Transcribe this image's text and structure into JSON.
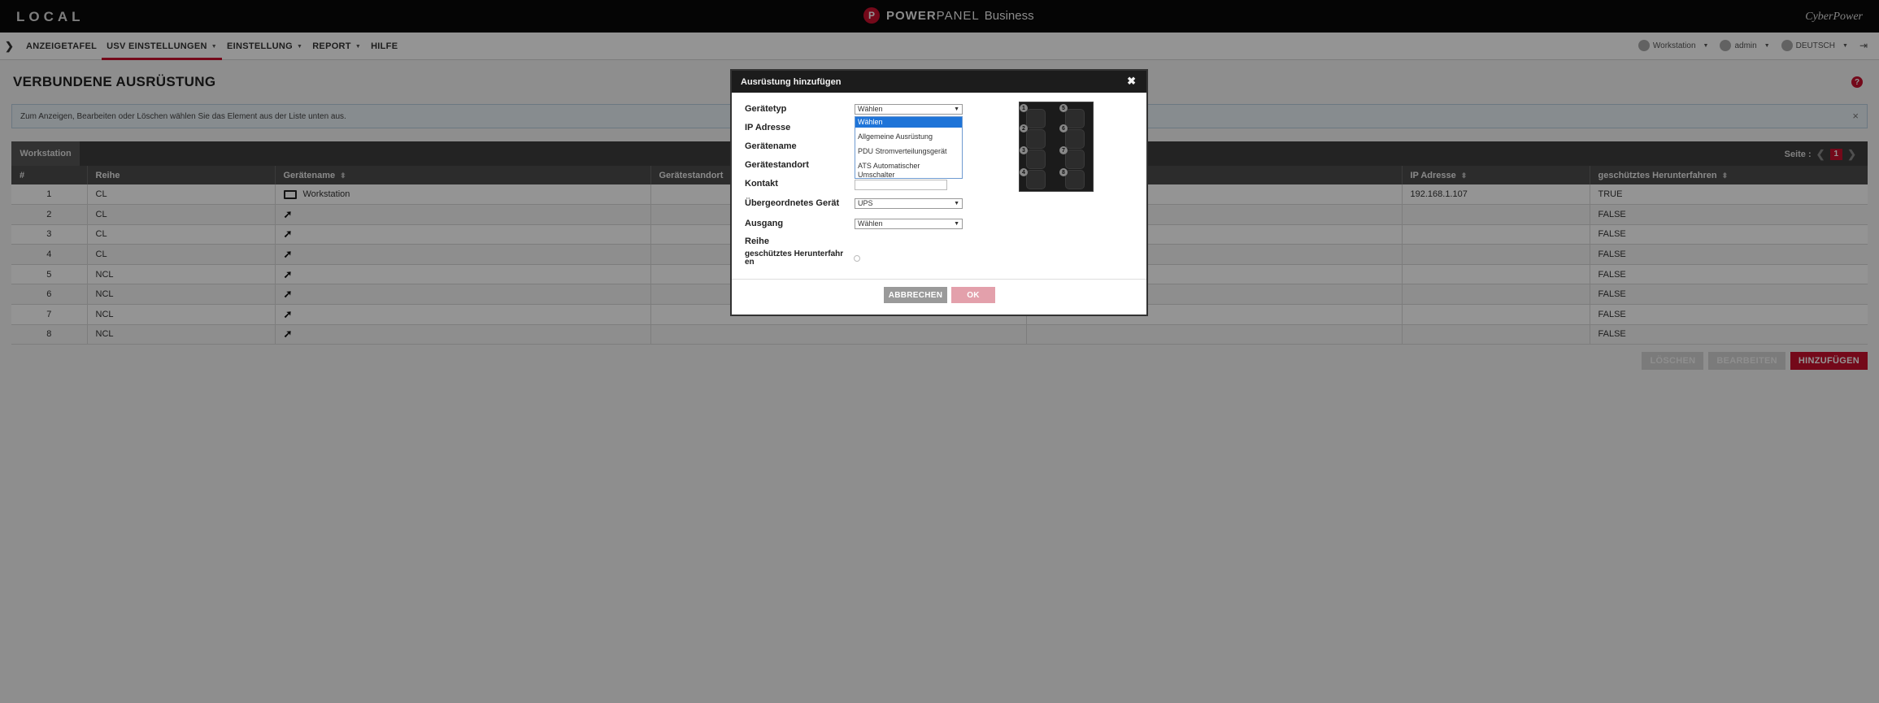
{
  "topbar": {
    "local_logo": "LOCAL",
    "product_brand_a": "POWER",
    "product_brand_b": "PANEL",
    "product_suffix": "Business",
    "vendor_logo": "CyberPower"
  },
  "nav": {
    "items": [
      {
        "label": "ANZEIGETAFEL",
        "active": false,
        "has_menu": false
      },
      {
        "label": "USV EINSTELLUNGEN",
        "active": true,
        "has_menu": true
      },
      {
        "label": "EINSTELLUNG",
        "active": false,
        "has_menu": true
      },
      {
        "label": "REPORT",
        "active": false,
        "has_menu": true
      },
      {
        "label": "HILFE",
        "active": false,
        "has_menu": false
      }
    ],
    "right": {
      "workstation": "Workstation",
      "user": "admin",
      "language": "DEUTSCH"
    }
  },
  "page": {
    "title": "VERBUNDENE AUSRÜSTUNG",
    "info_text": "Zum Anzeigen, Bearbeiten oder Löschen wählen Sie das Element aus der Liste unten aus.",
    "tab_label": "Workstation",
    "pager_label": "Seite :",
    "current_page": "1"
  },
  "table": {
    "columns": [
      "#",
      "Reihe",
      "Gerätename",
      "Gerätestandort",
      "",
      "IP Adresse",
      "geschütztes Herunterfahren"
    ],
    "rows": [
      {
        "num": "1",
        "reihe": "CL",
        "name": "Workstation",
        "icon": "workstation-icon",
        "ip": "192.168.1.107",
        "shutdown": "TRUE"
      },
      {
        "num": "2",
        "reihe": "CL",
        "name": "",
        "icon": "plug-icon",
        "ip": "",
        "shutdown": "FALSE"
      },
      {
        "num": "3",
        "reihe": "CL",
        "name": "",
        "icon": "plug-icon",
        "ip": "",
        "shutdown": "FALSE"
      },
      {
        "num": "4",
        "reihe": "CL",
        "name": "",
        "icon": "plug-icon",
        "ip": "",
        "shutdown": "FALSE"
      },
      {
        "num": "5",
        "reihe": "NCL",
        "name": "",
        "icon": "plug-icon",
        "ip": "",
        "shutdown": "FALSE"
      },
      {
        "num": "6",
        "reihe": "NCL",
        "name": "",
        "icon": "plug-icon",
        "ip": "",
        "shutdown": "FALSE"
      },
      {
        "num": "7",
        "reihe": "NCL",
        "name": "",
        "icon": "plug-icon",
        "ip": "",
        "shutdown": "FALSE"
      },
      {
        "num": "8",
        "reihe": "NCL",
        "name": "",
        "icon": "plug-icon",
        "ip": "",
        "shutdown": "FALSE"
      }
    ]
  },
  "actions": {
    "delete": "LÖSCHEN",
    "edit": "BEARBEITEN",
    "add": "HINZUFÜGEN"
  },
  "modal": {
    "title": "Ausrüstung hinzufügen",
    "labels": {
      "device_type": "Gerätetyp",
      "ip": "IP Adresse",
      "name": "Gerätename",
      "location": "Gerätestandort",
      "contact": "Kontakt",
      "parent": "Übergeordnetes Gerät",
      "outlet": "Ausgang",
      "row": "Reihe",
      "shutdown_a": "geschütztes Herunterfahr",
      "shutdown_b": "en"
    },
    "device_type_value": "Wählen",
    "parent_value": "UPS",
    "outlet_value": "Wählen",
    "dropdown_options": [
      "Wählen",
      "Allgemeine Ausrüstung",
      "PDU Stromverteilungsgerät",
      "ATS Automatischer",
      "Umschalter"
    ],
    "outlet_numbers": [
      "1",
      "2",
      "3",
      "4",
      "5",
      "6",
      "7",
      "8"
    ],
    "cancel": "ABBRECHEN",
    "ok": "OK"
  },
  "colors": {
    "accent": "#c8102e",
    "topbar": "#0a0a0a",
    "selected_option": "#1e74d8"
  }
}
